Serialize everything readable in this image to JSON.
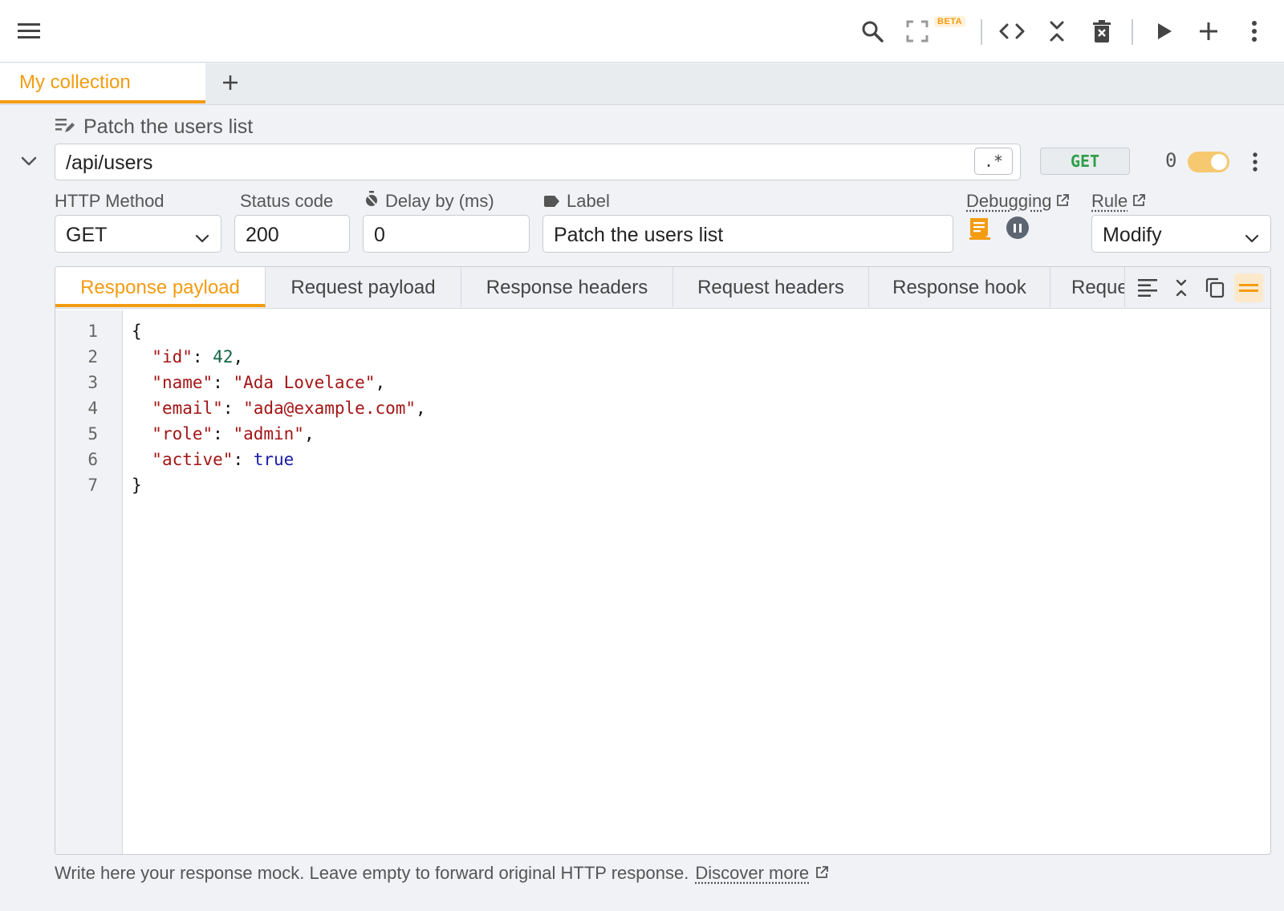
{
  "toolbar": {
    "beta_badge": "BETA"
  },
  "collection_tab": {
    "label": "My collection"
  },
  "rule": {
    "title": "Patch the users list",
    "url": "/api/users",
    "regex_label": ".*",
    "method_badge": "GET",
    "hit_count": "0",
    "enabled": true
  },
  "fields": {
    "http_method_label": "HTTP Method",
    "http_method_value": "GET",
    "status_code_label": "Status code",
    "status_code_value": "200",
    "delay_label": "Delay by (ms)",
    "delay_value": "0",
    "label_label": "Label",
    "label_value": "Patch the users list",
    "debugging_label": "Debugging",
    "rule_label": "Rule",
    "rule_value": "Modify"
  },
  "editor_tabs": [
    "Response payload",
    "Request payload",
    "Response headers",
    "Request headers",
    "Response hook",
    "Reque"
  ],
  "code_lines": {
    "l1": "{",
    "l2_key": "\"id\"",
    "l2_val": "42",
    "l3_key": "\"name\"",
    "l3_val": "\"Ada Lovelace\"",
    "l4_key": "\"email\"",
    "l4_val": "\"ada@example.com\"",
    "l5_key": "\"role\"",
    "l5_val": "\"admin\"",
    "l6_key": "\"active\"",
    "l6_val": "true",
    "l7": "}"
  },
  "line_numbers": [
    "1",
    "2",
    "3",
    "4",
    "5",
    "6",
    "7"
  ],
  "hint": {
    "text": "Write here your response mock. Leave empty to forward original HTTP response.",
    "link": "Discover more"
  },
  "colors": {
    "accent": "#f39c12",
    "method_get": "#2e9e48",
    "json_key": "#a31515",
    "json_number": "#116644",
    "json_bool": "#1a1aa6"
  }
}
